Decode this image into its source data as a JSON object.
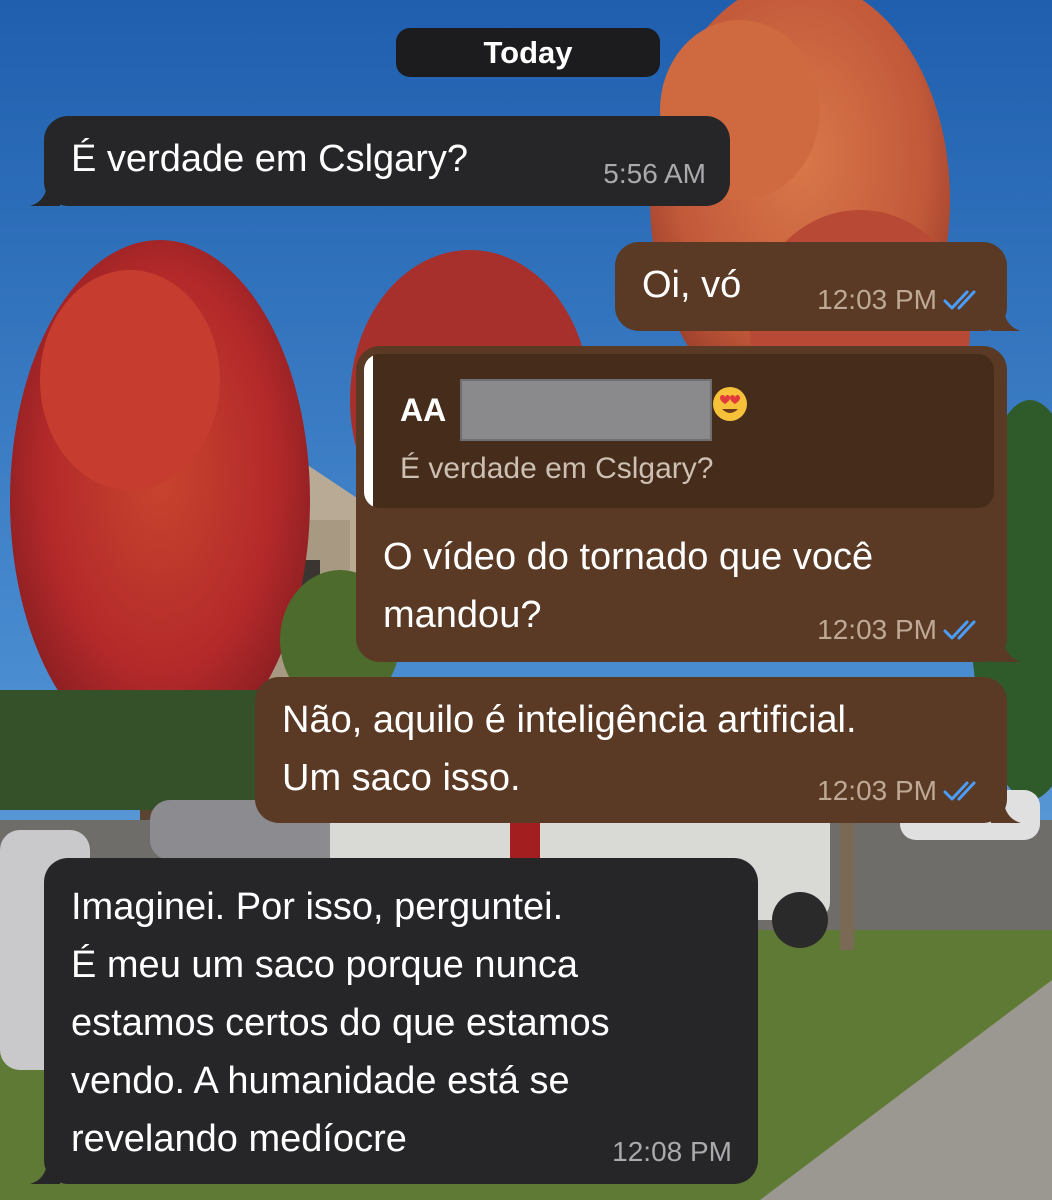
{
  "date_header": "Today",
  "messages": [
    {
      "id": "m1",
      "direction": "incoming",
      "text": "É  verdade em Cslgary?",
      "time": "5:56 AM"
    },
    {
      "id": "m2",
      "direction": "outgoing",
      "text": "Oi, vó",
      "time": "12:03 PM",
      "status": "read"
    },
    {
      "id": "m3",
      "direction": "outgoing",
      "reply_to": {
        "sender": "AA",
        "text": "É  verdade em Cslgary?"
      },
      "text": "O vídeo do tornado que você\nmandou?",
      "time": "12:03 PM",
      "status": "read"
    },
    {
      "id": "m4",
      "direction": "outgoing",
      "text": "Não, aquilo é inteligência artificial.\nUm saco isso.",
      "time": "12:03 PM",
      "status": "read"
    },
    {
      "id": "m5",
      "direction": "incoming",
      "text": "Imaginei.  Por isso, perguntei.\nÉ  meu um saco porque nunca\nestamos certos do que estamos\nvendo. A humanidade está  se\nrevelando medíocre",
      "time": "12:08 PM"
    }
  ],
  "colors": {
    "incoming_bubble": "#262628",
    "outgoing_bubble": "#5a3a24",
    "read_ticks": "#4a9eff",
    "date_pill": "#1c1c1e"
  },
  "icons": {
    "read_receipt": "double-check-icon",
    "emoji": "heart-eyes-emoji"
  }
}
